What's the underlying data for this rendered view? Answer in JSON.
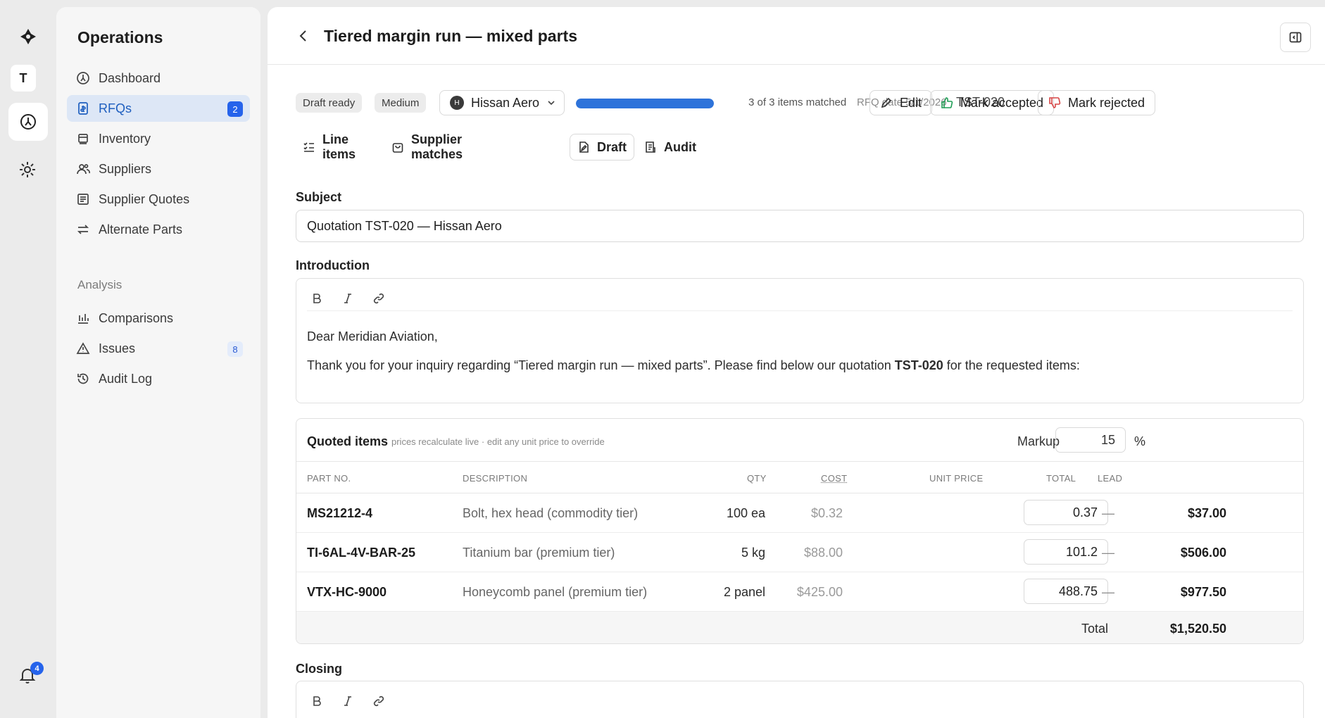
{
  "rail": {
    "workspace_initial": "T",
    "notification_count": "4"
  },
  "sidebar": {
    "title": "Operations",
    "items": [
      {
        "label": "Dashboard",
        "icon": "dashboard-icon"
      },
      {
        "label": "RFQs",
        "icon": "rfq-icon",
        "badge": "2"
      },
      {
        "label": "Inventory",
        "icon": "inventory-icon"
      },
      {
        "label": "Suppliers",
        "icon": "suppliers-icon"
      },
      {
        "label": "Supplier Quotes",
        "icon": "supplier-quotes-icon"
      },
      {
        "label": "Alternate Parts",
        "icon": "alternate-parts-icon"
      }
    ],
    "section_label": "Analysis",
    "analysis_items": [
      {
        "label": "Comparisons",
        "icon": "bar-chart-icon"
      },
      {
        "label": "Issues",
        "icon": "warning-icon",
        "badge": "8"
      },
      {
        "label": "Audit Log",
        "icon": "history-icon"
      }
    ]
  },
  "header": {
    "title": "Tiered margin run — mixed parts"
  },
  "status": {
    "state_pill": "Draft ready",
    "priority_pill": "Medium",
    "supplier_initial": "H",
    "supplier": "Hissan Aero",
    "progress_fraction": 1.0,
    "matched_text": "3 of 3 items matched",
    "rfq_date": "RFQ date 5/1/2026",
    "rfq_code": "TST-020",
    "edit_label": "Edit",
    "accept_label": "Mark accepted",
    "reject_label": "Mark rejected",
    "accept_color": "#1f9d55",
    "reject_color": "#d64545",
    "accent_color": "#2e73da"
  },
  "tabs": [
    {
      "label": "Line items"
    },
    {
      "label": "Supplier matches"
    },
    {
      "label": "Draft"
    },
    {
      "label": "Audit"
    }
  ],
  "draft": {
    "subject_label": "Subject",
    "subject_value": "Quotation TST-020 — Hissan Aero",
    "intro_label": "Introduction",
    "intro_greeting": "Dear Meridian Aviation,",
    "intro_body_before": "Thank you for your inquiry regarding “Tiered margin run — mixed parts”. Please find below our quotation ",
    "intro_body_bold": "TST-020",
    "intro_body_after": " for the requested items:",
    "closing_label": "Closing"
  },
  "quoted": {
    "title": "Quoted items",
    "hint": "prices recalculate live · edit any unit price to override",
    "markup_label": "Markup",
    "markup_value": "15",
    "markup_unit": "%",
    "columns": {
      "part": "PART NO.",
      "description": "DESCRIPTION",
      "qty": "QTY",
      "cost": "COST",
      "unit_price": "UNIT PRICE",
      "total": "TOTAL",
      "lead": "LEAD"
    },
    "rows": [
      {
        "part": "MS21212-4",
        "description": "Bolt, hex head (commodity tier)",
        "qty": "100 ea",
        "cost": "$0.32",
        "unit_price": "0.37",
        "total": "$37.00",
        "lead": "—"
      },
      {
        "part": "TI-6AL-4V-BAR-25",
        "description": "Titanium bar (premium tier)",
        "qty": "5 kg",
        "cost": "$88.00",
        "unit_price": "101.2",
        "total": "$506.00",
        "lead": "—"
      },
      {
        "part": "VTX-HC-9000",
        "description": "Honeycomb panel (premium tier)",
        "qty": "2 panel",
        "cost": "$425.00",
        "unit_price": "488.75",
        "total": "$977.50",
        "lead": "—"
      }
    ],
    "total_label": "Total",
    "total_value": "$1,520.50"
  }
}
